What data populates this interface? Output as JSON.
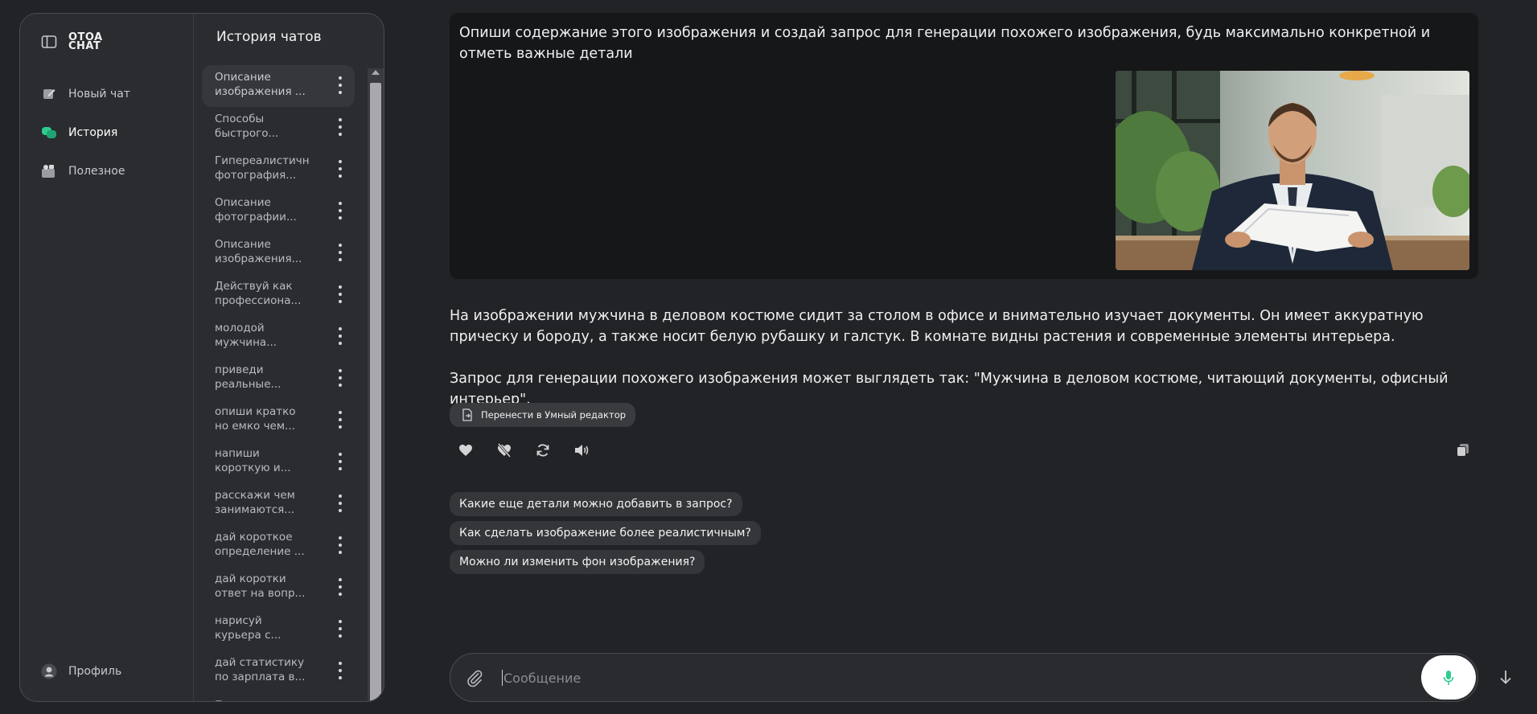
{
  "nav": {
    "logo": "OTOA CHAT",
    "items": [
      {
        "label": "Новый чат",
        "icon": "pencil-icon"
      },
      {
        "label": "История",
        "icon": "chat-bubbles-icon",
        "active": true
      },
      {
        "label": "Полезное",
        "icon": "collection-icon"
      }
    ],
    "profile": "Профиль"
  },
  "history": {
    "title": "История чатов",
    "items": [
      "Описание\nизображения ...",
      "Способы\nбыстрого...",
      "Гипереалистичн\nфотография...",
      "Описание\nфотографии...",
      "Описание\nизображения...",
      "Действуй как\nпрофессиона...",
      "молодой\nмужчина...",
      "приведи\nреальные...",
      "опиши кратко\nно емко чем...",
      "напиши\nкороткую и...",
      "расскажи чем\nзанимаются...",
      "дай короткое\nопределение ...",
      "дай коротки\nответ на вопр...",
      "нарисуй\nкурьера с...",
      "дай статистику\nпо зарплата в..."
    ],
    "peek": "П"
  },
  "conversation": {
    "user_message": "Опиши содержание этого изображения и создай запрос для генерации похожего изображения, будь максимально конкретной и отметь важные детали",
    "answer_p1": "На изображении мужчина в деловом костюме сидит за столом в офисе и внимательно изучает документы. Он имеет аккуратную прическу и бороду, а также носит белую рубашку и галстук. В комнате видны растения и современные элементы интерьера.",
    "answer_p2": "Запрос для генерации похожего изображения может выглядеть так: \"Мужчина в деловом костюме, читающий документы, офисный интерьер\".",
    "smart_editor_label": "Перенести в Умный редактор",
    "suggestions": [
      "Какие еще детали можно добавить в запрос?",
      "Как сделать изображение более реалистичным?",
      "Можно ли изменить фон изображения?"
    ]
  },
  "composer": {
    "placeholder": "Сообщение"
  },
  "colors": {
    "background": "#222326",
    "panel": "#2a2c30",
    "accent": "#2ecc8f",
    "user_bubble": "#161719"
  }
}
